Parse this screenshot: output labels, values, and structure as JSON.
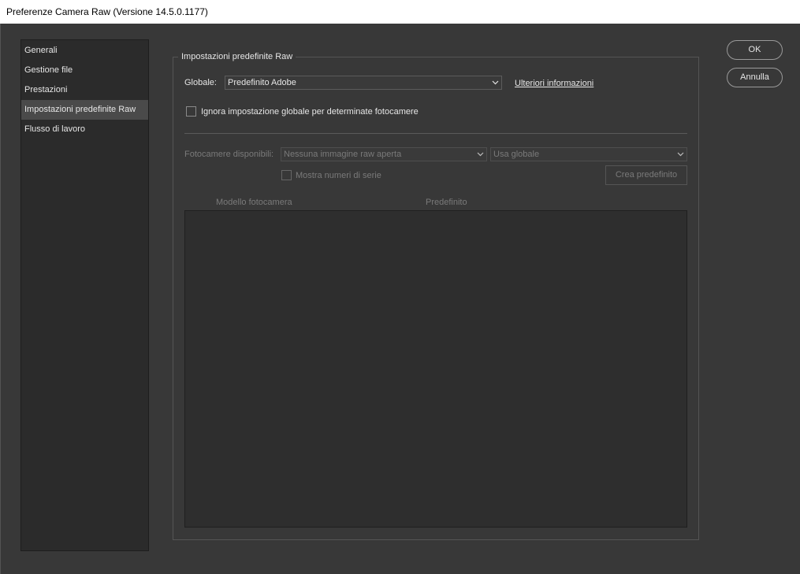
{
  "window": {
    "title": "Preferenze Camera Raw  (Versione 14.5.0.1177)"
  },
  "sidebar": {
    "items": [
      {
        "label": "Generali"
      },
      {
        "label": "Gestione file"
      },
      {
        "label": "Prestazioni"
      },
      {
        "label": "Impostazioni predefinite Raw"
      },
      {
        "label": "Flusso di lavoro"
      }
    ],
    "active_index": 3
  },
  "panel": {
    "legend": "Impostazioni predefinite Raw",
    "global_label": "Globale:",
    "global_value": "Predefinito Adobe",
    "more_info_link": "Ulteriori informazioni",
    "override_checkbox_label": "Ignora impostazione globale per determinate fotocamere",
    "override_checked": false,
    "cameras_label": "Fotocamere disponibili:",
    "cameras_value": "Nessuna immagine raw aperta",
    "camera_default_value": "Usa globale",
    "serial_checkbox_label": "Mostra numeri di serie",
    "serial_checked": false,
    "create_default_button": "Crea predefinito",
    "table": {
      "columns": [
        "Modello fotocamera",
        "Predefinito"
      ],
      "rows": []
    }
  },
  "buttons": {
    "ok": "OK",
    "cancel": "Annulla"
  },
  "icons": {
    "dropdown": "chevron-down-icon"
  },
  "colors": {
    "background": "#383838",
    "sidebar": "#2b2b2b",
    "active_item": "#4a4a4a",
    "disabled_text": "#7a7a7a"
  }
}
